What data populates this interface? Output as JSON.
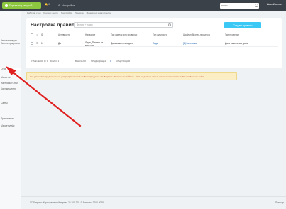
{
  "topbar": {
    "button_label": "Портал под защитой",
    "bell_label": "0",
    "settings_label": "Настройки",
    "search_placeholder": "поиск...",
    "user": "Иван Иванов"
  },
  "leftmenu": {
    "items": [
      {
        "label": "Автоматизация бизнес-процессов"
      },
      {
        "label": "CRM"
      },
      {
        "label": "Маркетинг"
      },
      {
        "label": "Настройки CRM"
      },
      {
        "label": "Контакт-центр"
      },
      {
        "label": "Сайты"
      },
      {
        "label": "Приложения"
      },
      {
        "label": "Маркетплейс"
      }
    ]
  },
  "breadcrumbs": [
    "Рабочий стол",
    "Контакт-центр",
    "Настройки",
    "Правила",
    "Менеджер задач сделок"
  ],
  "page": {
    "title": "Настройка правил",
    "filter_placeholder": "Фильтр + поиск",
    "create_button": "Создать правило"
  },
  "table": {
    "headers": [
      "ID",
      "Активность",
      "Название",
      "Тип сделок для проверки",
      "Тип сущности",
      "Шаблон бизнес-процесса",
      "Тип проверки"
    ],
    "rows": [
      {
        "id": "1",
        "active": "Да",
        "name": "Лиды_Письмо от клиента",
        "deal_type": "Дата изменения дела",
        "entity": "Лиды",
        "template": "[1] Заготовка",
        "check": "Дата изменения дела"
      }
    ],
    "footer": {
      "selected": "ОТМЕЧЕНО: 0 / 1",
      "total": "ВСЕГО: 1",
      "first": "В НАЧАЛО",
      "prev": "ПРЕДЫДУЩАЯ",
      "page": "1",
      "next": "СЛЕДУЮЩАЯ"
    }
  },
  "warning": "Эта установка предназначена для разработчиков на базе продукта «1С-Битрикс: Управление сайтом». Она не должна использоваться в качестве рабочего боевого сайта.",
  "footer": {
    "copyright": "1С-Битрикс: Корпоративный портал 25.100.200. © Битрикс, 2002-2025",
    "right": "Помощь"
  },
  "colors": {
    "topbar": "#3b4148",
    "accent_green": "#8dc63f",
    "create_button": "#3bc8f5",
    "warning_bg": "#fbeec4",
    "arrow": "#e02020"
  }
}
